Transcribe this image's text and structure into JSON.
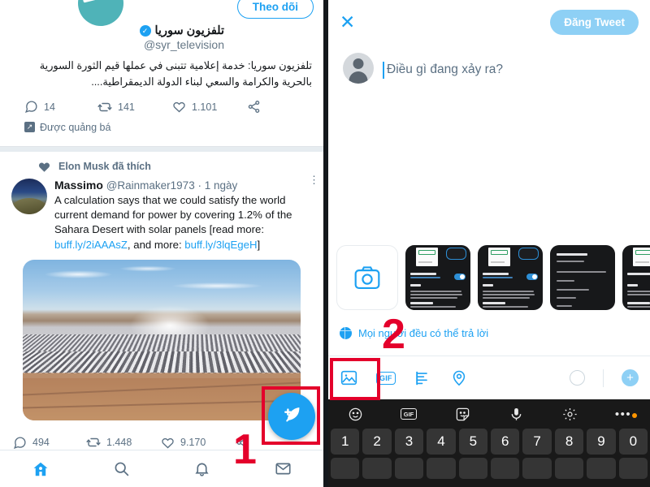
{
  "meta": {
    "accent_blue": "#1da1f2",
    "annotation_red": "#e4002b",
    "text_gray": "#5b7083"
  },
  "left_panel": {
    "promoted_tweet": {
      "follow_button": "Theo dõi",
      "display_name": "تلفزيون سوريا",
      "verified_glyph": "✓",
      "handle": "@syr_television",
      "body": "تلفزيون سوريا: خدمة إعلامية تتبنى في عملها قيم الثورة السورية بالحرية والكرامة والسعي لبناء الدولة الديمقراطية....",
      "stats": {
        "replies": "14",
        "retweets": "141",
        "likes": "1.101"
      },
      "promoted_label": "Được quảng bá",
      "promoted_glyph": "↗"
    },
    "liked_tweet": {
      "liked_by": "Elon Musk đã thích",
      "author_name": "Massimo",
      "author_handle": "@Rainmaker1973",
      "time_sep": "·",
      "time": "1 ngày",
      "text_part1": "A calculation says that we could satisfy the world current demand for power by covering 1.2% of the Sahara Desert with solar panels [read more: ",
      "link1": "buff.ly/2iAAAsZ",
      "text_part2": ", and more: ",
      "link2": "buff.ly/3lqEgeH",
      "text_part3": "]",
      "stats": {
        "replies": "494",
        "retweets": "1.448",
        "likes": "9.170"
      }
    },
    "compose_fab": "compose-tweet",
    "bottom_nav": [
      {
        "name": "home",
        "label": "Trang chủ",
        "active": true
      },
      {
        "name": "search",
        "label": "Tìm kiếm",
        "active": false
      },
      {
        "name": "notifications",
        "label": "Thông báo",
        "active": false
      },
      {
        "name": "messages",
        "label": "Tin nhắn",
        "active": false
      }
    ]
  },
  "right_panel": {
    "header": {
      "close": "✕",
      "post_button": "Đăng Tweet"
    },
    "composer": {
      "placeholder": "Điều gì đang xảy ra?",
      "value": ""
    },
    "media_strip": {
      "camera_label": "camera",
      "thumbnail_count": 5
    },
    "reply_setting": "Mọi người đều có thể trả lời",
    "toolbar": [
      {
        "name": "image",
        "label": "Ảnh"
      },
      {
        "name": "gif",
        "label": "GIF"
      },
      {
        "name": "poll",
        "label": "Bình chọn"
      },
      {
        "name": "location",
        "label": "Vị trí"
      }
    ],
    "toolbar_right": {
      "progress": "0",
      "add": "+"
    },
    "keyboard": {
      "toolbar": [
        {
          "name": "emoji",
          "label": "☺"
        },
        {
          "name": "gif",
          "label": "GIF"
        },
        {
          "name": "sticker",
          "label": "sticker"
        },
        {
          "name": "mic",
          "label": "mic"
        },
        {
          "name": "settings",
          "label": "settings"
        },
        {
          "name": "more",
          "label": "•••"
        }
      ],
      "number_row": [
        "1",
        "2",
        "3",
        "4",
        "5",
        "6",
        "7",
        "8",
        "9",
        "0"
      ]
    }
  },
  "annotations": [
    {
      "id": "1",
      "number": "1",
      "target": "share-and-compose-fab"
    },
    {
      "id": "2",
      "number": "2",
      "target": "image-attach-button"
    }
  ]
}
